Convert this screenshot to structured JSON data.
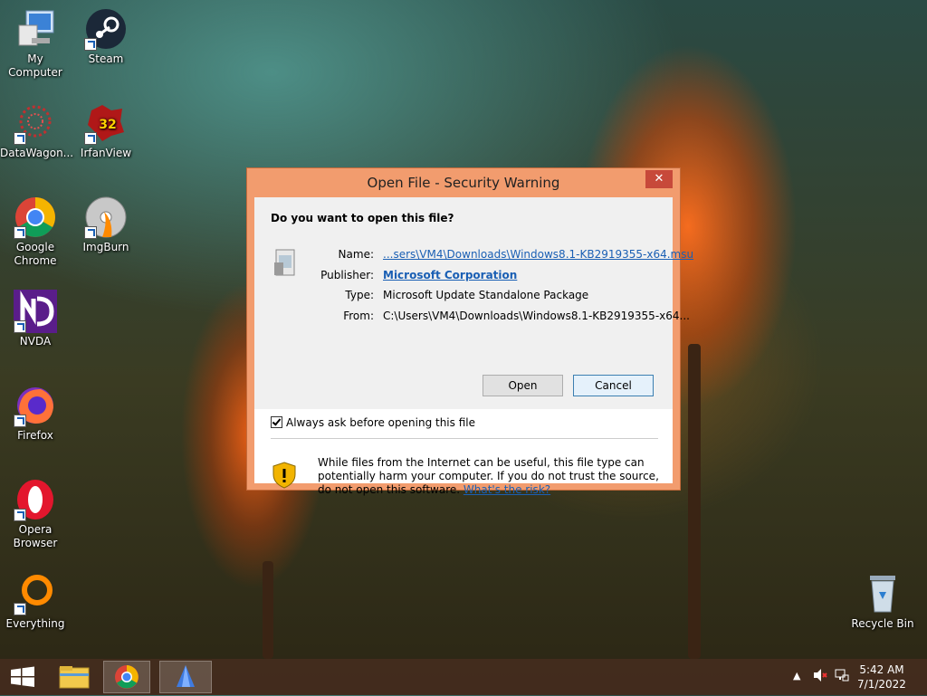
{
  "desktop": {
    "icons": [
      {
        "label": "My Computer",
        "icon": "computer-icon"
      },
      {
        "label": "Steam",
        "icon": "steam-icon"
      },
      {
        "label": "DataWagon...",
        "icon": "datawagon-icon"
      },
      {
        "label": "IrfanView",
        "icon": "irfanview-icon"
      },
      {
        "label": "Google Chrome",
        "icon": "chrome-icon"
      },
      {
        "label": "ImgBurn",
        "icon": "imgburn-icon"
      },
      {
        "label": "NVDA",
        "icon": "nvda-icon"
      },
      {
        "label": "Firefox",
        "icon": "firefox-icon"
      },
      {
        "label": "Opera Browser",
        "icon": "opera-icon"
      },
      {
        "label": "Everything",
        "icon": "everything-icon"
      },
      {
        "label": "Recycle Bin",
        "icon": "recycle-bin-icon"
      }
    ],
    "irfanview_badge": "32"
  },
  "dialog": {
    "title": "Open File - Security Warning",
    "close_glyph": "✕",
    "question": "Do you want to open this file?",
    "fields": {
      "name_label": "Name:",
      "name_value": "...sers\\VM4\\Downloads\\Windows8.1-KB2919355-x64.msu",
      "publisher_label": "Publisher:",
      "publisher_value": "Microsoft Corporation",
      "type_label": "Type:",
      "type_value": "Microsoft Update Standalone Package",
      "from_label": "From:",
      "from_value": "C:\\Users\\VM4\\Downloads\\Windows8.1-KB2919355-x64..."
    },
    "open_button": "Open",
    "cancel_button": "Cancel",
    "always_ask_label": "Always ask before opening this file",
    "always_ask_checked": true,
    "warning_text": "While files from the Internet can be useful, this file type can potentially harm your computer. If you do not trust the source, do not open this software.",
    "risk_link": "What's the risk?"
  },
  "taskbar": {
    "time": "5:42 AM",
    "date": "7/1/2022",
    "pinned": [
      "start-icon",
      "file-explorer-icon",
      "chrome-icon",
      "app-icon"
    ]
  },
  "colors": {
    "dialog_frame": "#f29c6e",
    "close_button": "#c7493a",
    "link": "#1a5fb4"
  }
}
